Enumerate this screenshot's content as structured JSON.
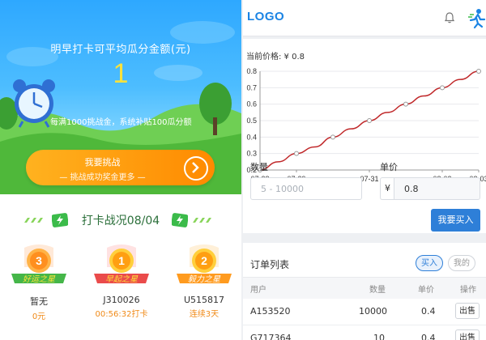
{
  "left": {
    "headline": "明早打卡可平均瓜分金额(元)",
    "amount": "1",
    "subline": "每满1000挑战金，系统补贴100瓜分额",
    "challenge_button": {
      "label": "我要挑战",
      "sub": "挑战成功奖金更多"
    },
    "section_title": "打卡战况08/04",
    "badges": [
      {
        "rank": "3",
        "title": "好运之星",
        "name": "暂无",
        "sub": "0元"
      },
      {
        "rank": "1",
        "title": "早起之星",
        "name": "J310026",
        "sub": "00:56:32打卡"
      },
      {
        "rank": "2",
        "title": "毅力之星",
        "name": "U515817",
        "sub": "连续3天"
      }
    ]
  },
  "right": {
    "logo": "LOGO",
    "price_label": "当前价格: ¥ 0.8",
    "chart_data": {
      "type": "line",
      "x": [
        "07-28",
        "07-28.5",
        "07-29",
        "07-29.5",
        "07-30",
        "07-30.5",
        "07-31",
        "07-31.5",
        "08-01",
        "08-01.5",
        "08-02",
        "08-02.5",
        "08-03"
      ],
      "categories": [
        "07-28",
        "07-29",
        "07-31",
        "08-02",
        "08-03"
      ],
      "values": [
        0.2,
        0.25,
        0.3,
        0.34,
        0.4,
        0.45,
        0.5,
        0.55,
        0.6,
        0.65,
        0.7,
        0.75,
        0.8
      ],
      "ylim": [
        0.2,
        0.8
      ],
      "yticks": [
        "0.2",
        "0.3",
        "0.4",
        "0.5",
        "0.6",
        "0.7",
        "0.8"
      ],
      "line_color": "#c0282a"
    },
    "qty_label": "数量",
    "qty_placeholder": "5 - 10000",
    "unit_label": "单价",
    "yen_symbol": "¥",
    "unit_value": "0.8",
    "buy_button": "我要买入",
    "orders": {
      "title": "订单列表",
      "tab_buy": "买入",
      "tab_mine": "我的",
      "columns": [
        "用户",
        "数量",
        "单价",
        "操作"
      ],
      "rows": [
        {
          "user": "A153520",
          "qty": "10000",
          "price": "0.4",
          "action": "出售"
        },
        {
          "user": "G717364",
          "qty": "10",
          "price": "0.4",
          "action": "出售"
        }
      ]
    }
  }
}
